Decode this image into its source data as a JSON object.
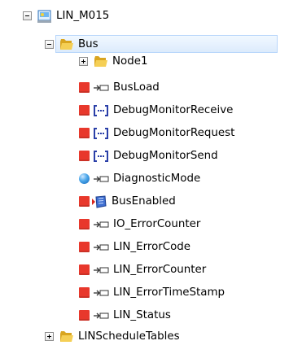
{
  "tree": {
    "root": {
      "label": "LIN_M015"
    },
    "bus": {
      "label": "Bus"
    },
    "node1": {
      "label": "Node1"
    },
    "items": [
      {
        "label": "BusLoad"
      },
      {
        "label": "DebugMonitorReceive"
      },
      {
        "label": "DebugMonitorRequest"
      },
      {
        "label": "DebugMonitorSend"
      },
      {
        "label": "DiagnosticMode"
      },
      {
        "label": "BusEnabled"
      },
      {
        "label": "IO_ErrorCounter"
      },
      {
        "label": "LIN_ErrorCode"
      },
      {
        "label": "LIN_ErrorCounter"
      },
      {
        "label": "LIN_ErrorTimeStamp"
      },
      {
        "label": "LIN_Status"
      }
    ],
    "schedule": {
      "label": "LINScheduleTables"
    }
  },
  "colors": {
    "status_red": "#e8382c",
    "status_blue": "#3b94dc",
    "selection_border": "#b8d6fb",
    "folder_yellow": "#f2c53c"
  },
  "icons": {
    "root": "module-icon",
    "folder": "folder-icon",
    "signal": "signal-connector-icon",
    "debug": "bracket-dots-icon",
    "bus_enabled": "bus-enabled-icon"
  }
}
